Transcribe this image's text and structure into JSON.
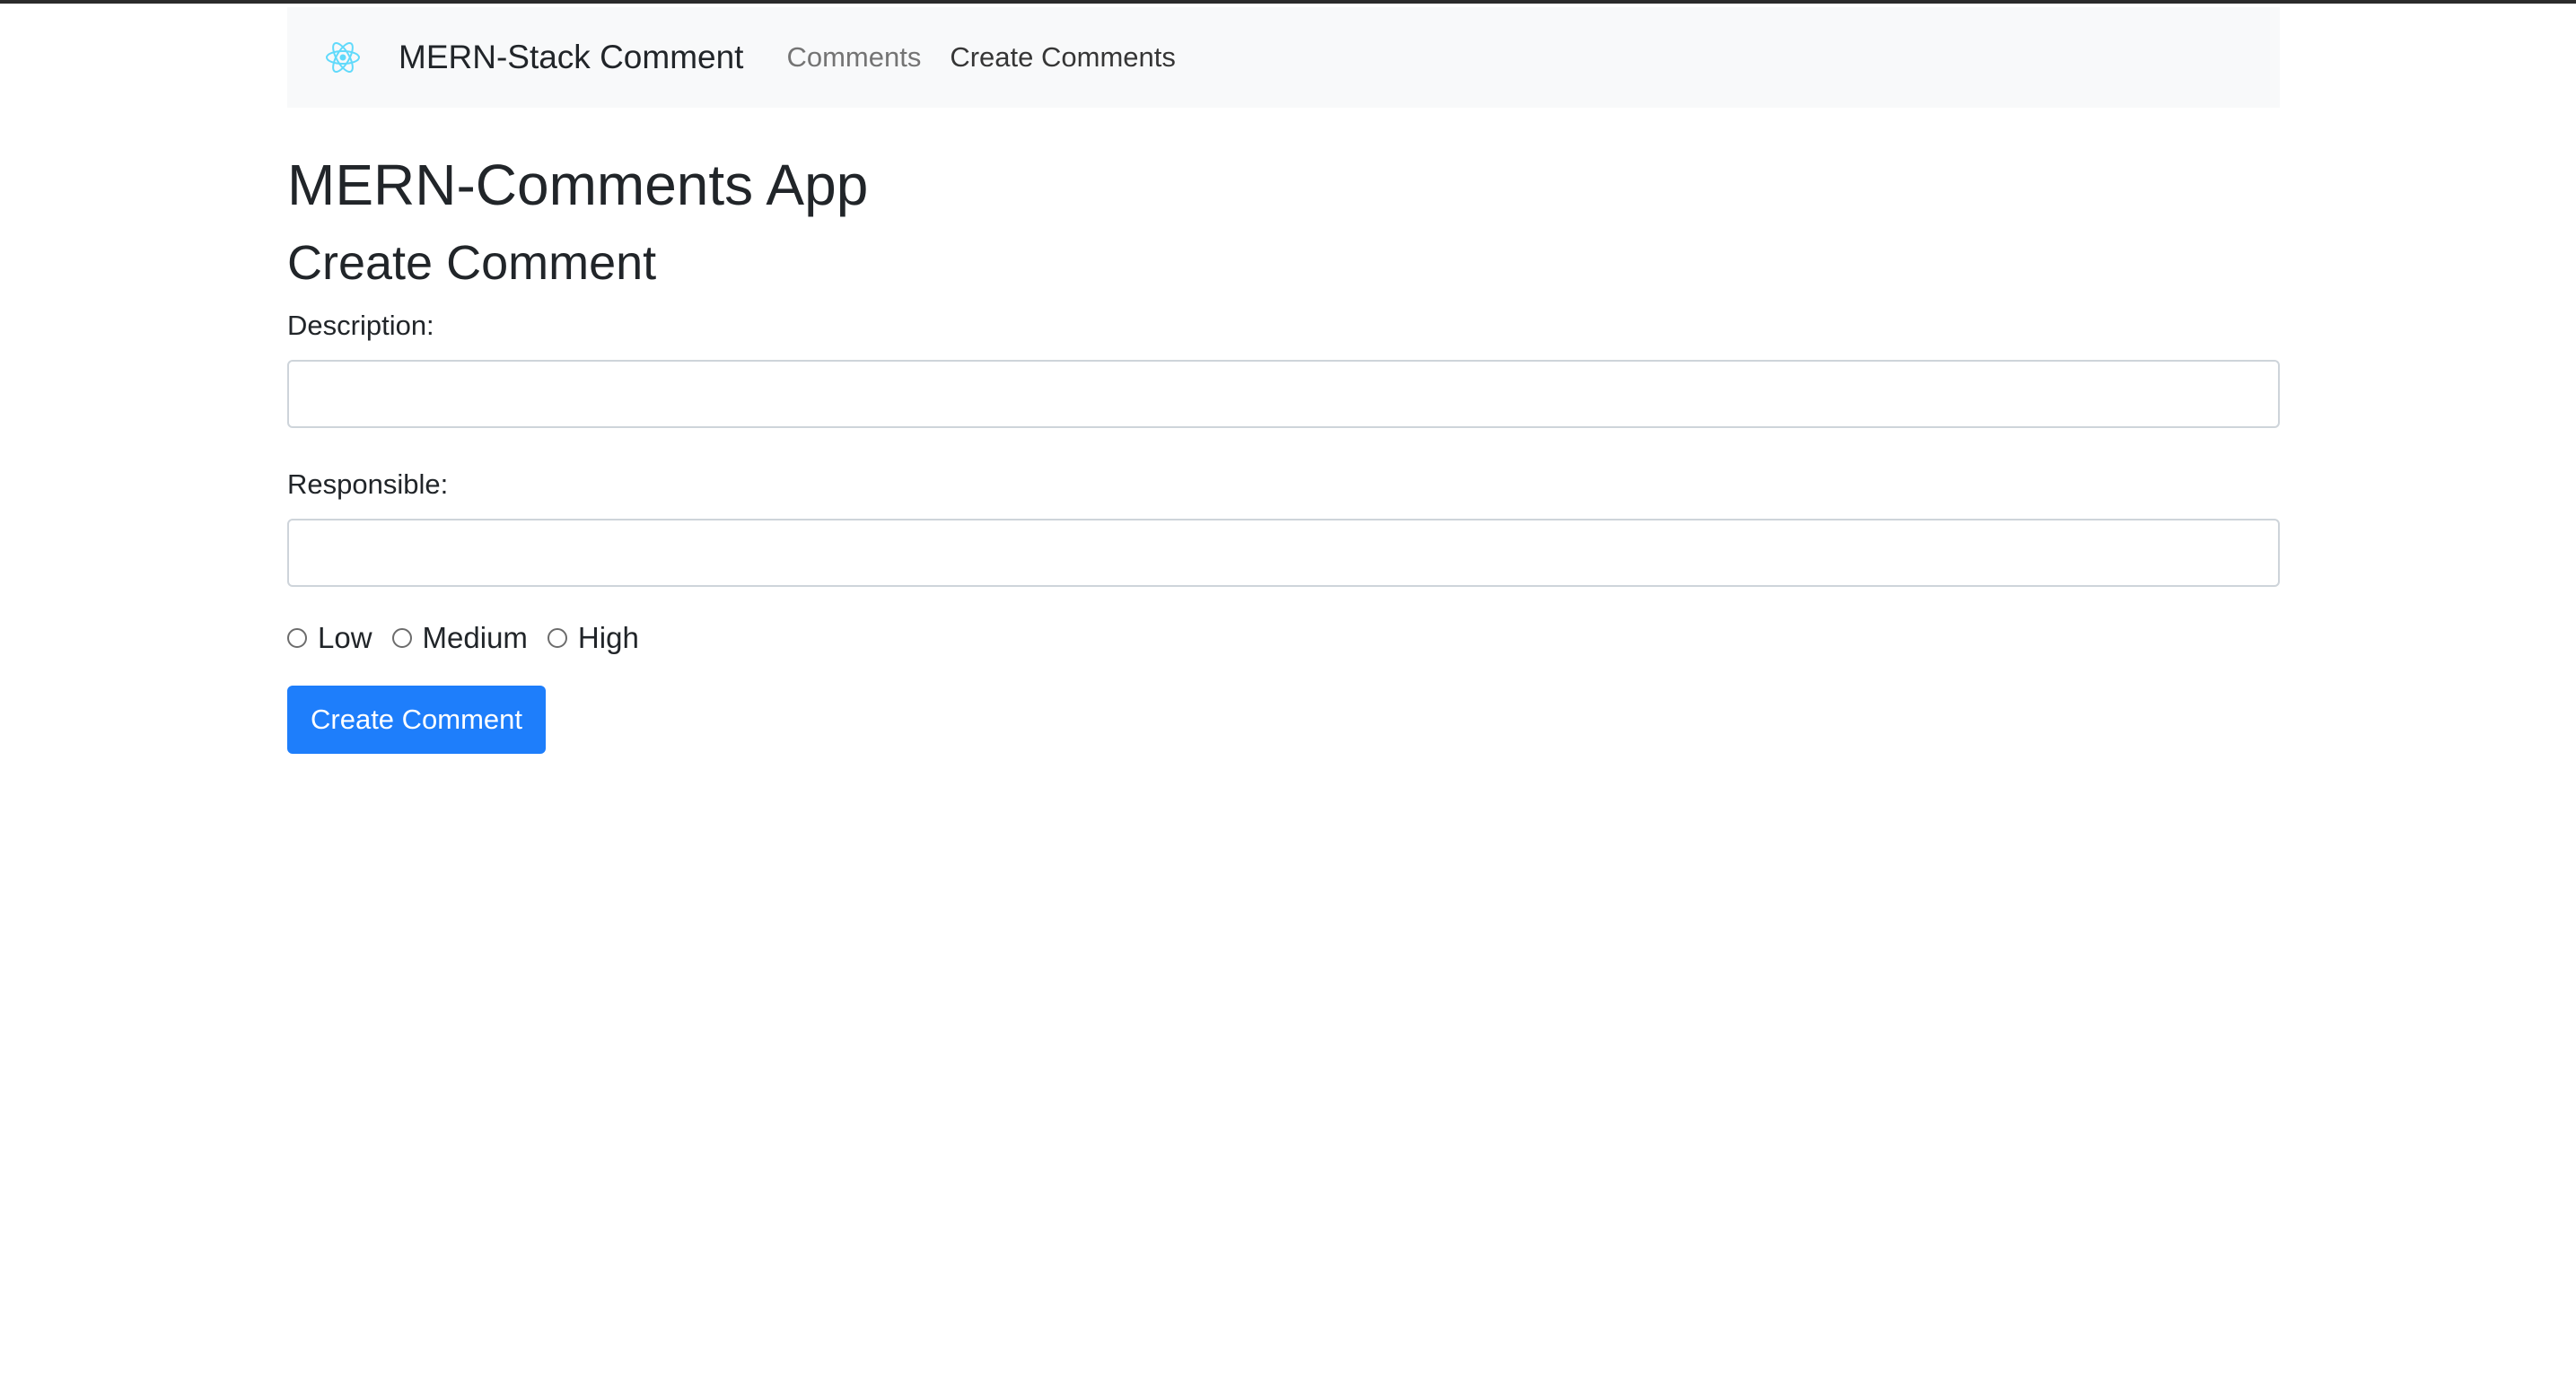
{
  "navbar": {
    "logo_icon": "react-atom-icon",
    "logo_color": "#61dafb",
    "brand": "MERN-Stack Comment",
    "links": [
      {
        "label": "Comments"
      },
      {
        "label": "Create Comments"
      }
    ]
  },
  "main": {
    "app_title": "MERN-Comments App",
    "form_title": "Create Comment",
    "description_label": "Description:",
    "description_value": "",
    "responsible_label": "Responsible:",
    "responsible_value": "",
    "priority_options": [
      {
        "label": "Low",
        "checked": false
      },
      {
        "label": "Medium",
        "checked": false
      },
      {
        "label": "High",
        "checked": false
      }
    ],
    "submit_label": "Create Comment"
  },
  "colors": {
    "accent": "#1e7efb",
    "navbar_bg": "#f8f9fa",
    "text": "#212529"
  }
}
